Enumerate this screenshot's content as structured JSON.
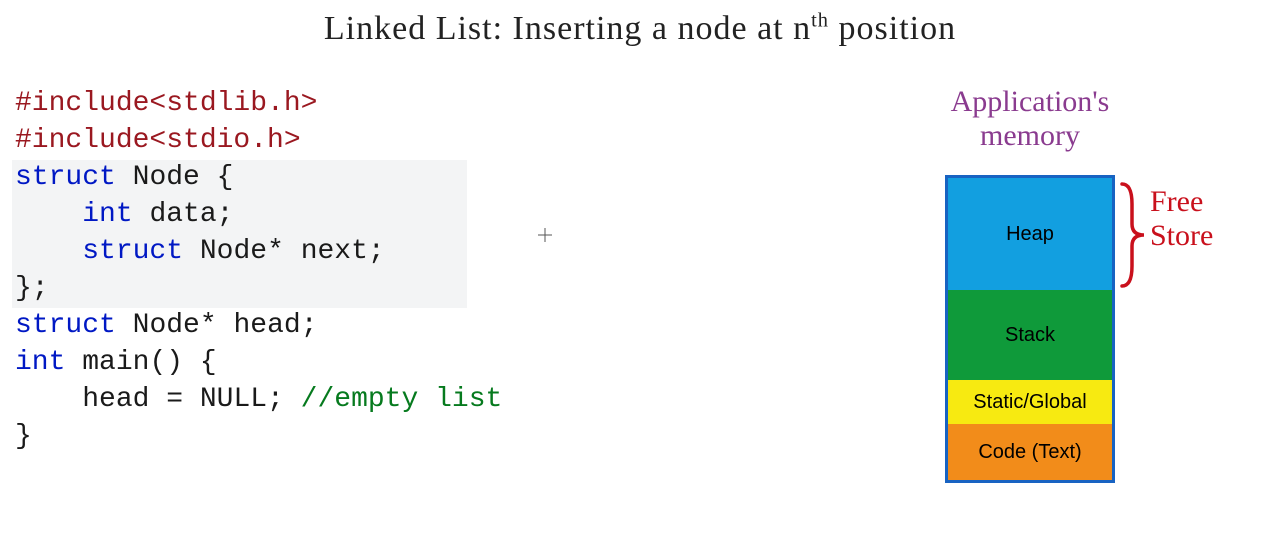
{
  "title_html": "Linked List: Inserting a node at n<sup>th</sup> position",
  "memory_title": "Application's<br>memory",
  "memory_segments": {
    "heap": "Heap",
    "stack": "Stack",
    "static": "Static/Global",
    "code": "Code (Text)"
  },
  "free_store_label": "Free<br>Store",
  "code": {
    "include_kw": "#include",
    "header1": "<stdlib.h>",
    "header2": "<stdio.h>",
    "struct_kw": "struct",
    "node_name": "Node",
    "int_kw": "int",
    "data_field": "data",
    "next_field": "next",
    "head_var": "head",
    "main_name": "main",
    "null_assign": "head = NULL;",
    "comment": "//empty list"
  }
}
